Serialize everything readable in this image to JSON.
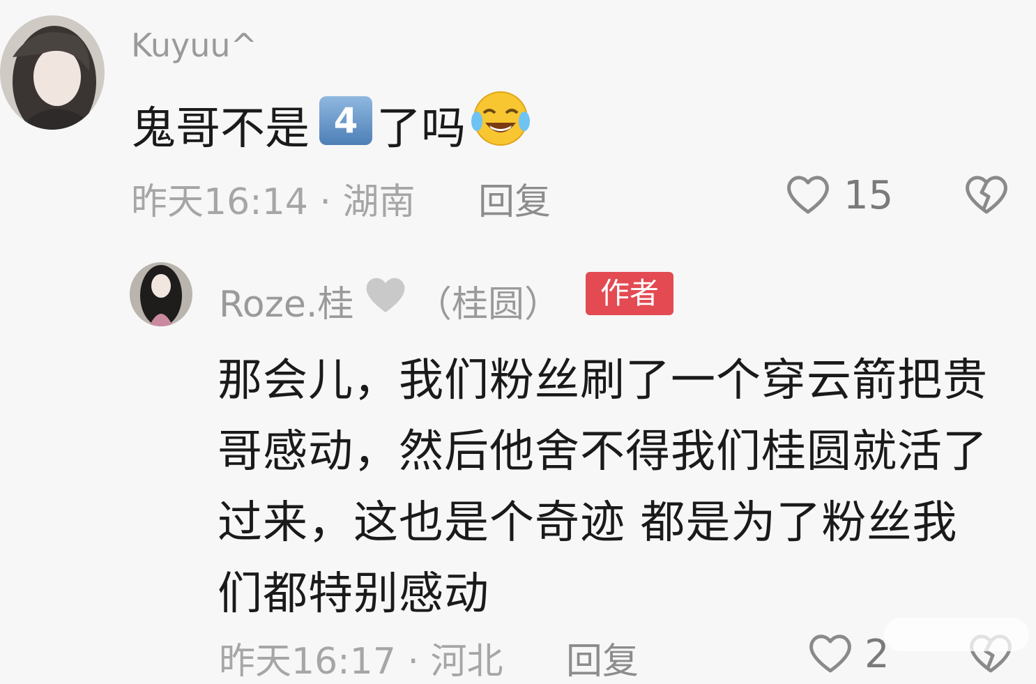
{
  "comments": [
    {
      "username": "Kuyuu^",
      "text_before": "鬼哥不是",
      "keycap_number": "4",
      "text_after": "了吗",
      "emoji": "rolling-on-floor-laughing-emoji",
      "meta": "昨天16:14 · 湖南",
      "reply_label": "回复",
      "likes": "15"
    },
    {
      "username_part1": "Roze.桂",
      "username_emoji": "white-heart-emoji",
      "username_part2": "（桂圆）",
      "badge": "作者",
      "lines": [
        "那会儿，我们粉丝刷了一个穿云箭把贵",
        "哥感动，然后他舍不得我们桂圆就活了",
        "过来，这也是个奇迹 都是为了粉丝我",
        "们都特别感动"
      ],
      "meta": "昨天16:17 · 河北",
      "reply_label": "回复",
      "likes": "2"
    }
  ],
  "colors": {
    "background": "#f7f7f7",
    "badge": "#e34a52",
    "meta_text": "#a6a6a6"
  }
}
